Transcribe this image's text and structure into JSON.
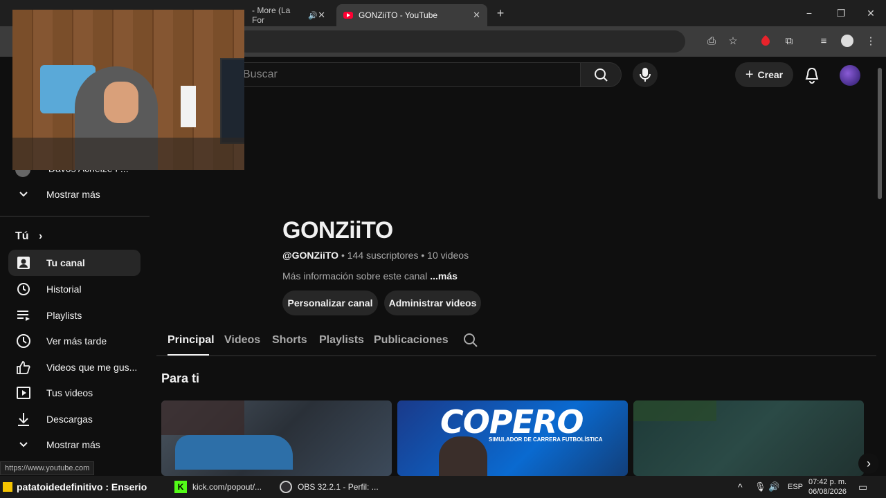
{
  "browser": {
    "tabs": [
      {
        "title": "- More (La For",
        "active": false
      },
      {
        "title": "GONZiiTO - YouTube",
        "active": true
      }
    ],
    "new_tab": "+",
    "window": {
      "minimize": "−",
      "maximize": "❐",
      "close": "✕"
    }
  },
  "youtube": {
    "search_placeholder": "Buscar",
    "create_label": "Crear",
    "sidebar": {
      "partial_item": "Davos Acheize P...",
      "show_more_1": "Mostrar más",
      "you_header": "Tú",
      "items": [
        {
          "label": "Tu canal",
          "icon": "person-icon",
          "selected": true
        },
        {
          "label": "Historial",
          "icon": "history-icon"
        },
        {
          "label": "Playlists",
          "icon": "playlist-icon"
        },
        {
          "label": "Ver más tarde",
          "icon": "clock-icon"
        },
        {
          "label": "Videos que me gus...",
          "icon": "thumbs-up-icon"
        },
        {
          "label": "Tus videos",
          "icon": "video-icon"
        },
        {
          "label": "Descargas",
          "icon": "download-icon"
        }
      ],
      "show_more_2": "Mostrar más"
    },
    "channel": {
      "name": "GONZiiTO",
      "handle": "@GONZiiTO",
      "subscribers": "144 suscriptores",
      "videos": "10 videos",
      "about": "Más información sobre este canal",
      "about_more": "...más",
      "customize_button": "Personalizar canal",
      "manage_button": "Administrar videos",
      "tabs": [
        "Principal",
        "Videos",
        "Shorts",
        "Playlists",
        "Publicaciones"
      ],
      "section_title": "Para ti",
      "thumb_text": "COPERO",
      "thumb_subtext": "SIMULADOR DE CARRERA FUTBOLÍSTICA"
    }
  },
  "status_url": "https://www.youtube.com",
  "taskbar": {
    "apps": [
      {
        "label": "patatoidedefinitivo : Enserio"
      },
      {
        "label": "kick.com/popout/..."
      },
      {
        "label": "OBS 32.2.1 - Perfil: ..."
      }
    ],
    "language": "ESP",
    "time": "07:42 p. m.",
    "date": "06/08/2026"
  },
  "colors": {
    "accent_red": "#ff0033",
    "bg": "#0f0f0f",
    "surface": "#272727"
  }
}
